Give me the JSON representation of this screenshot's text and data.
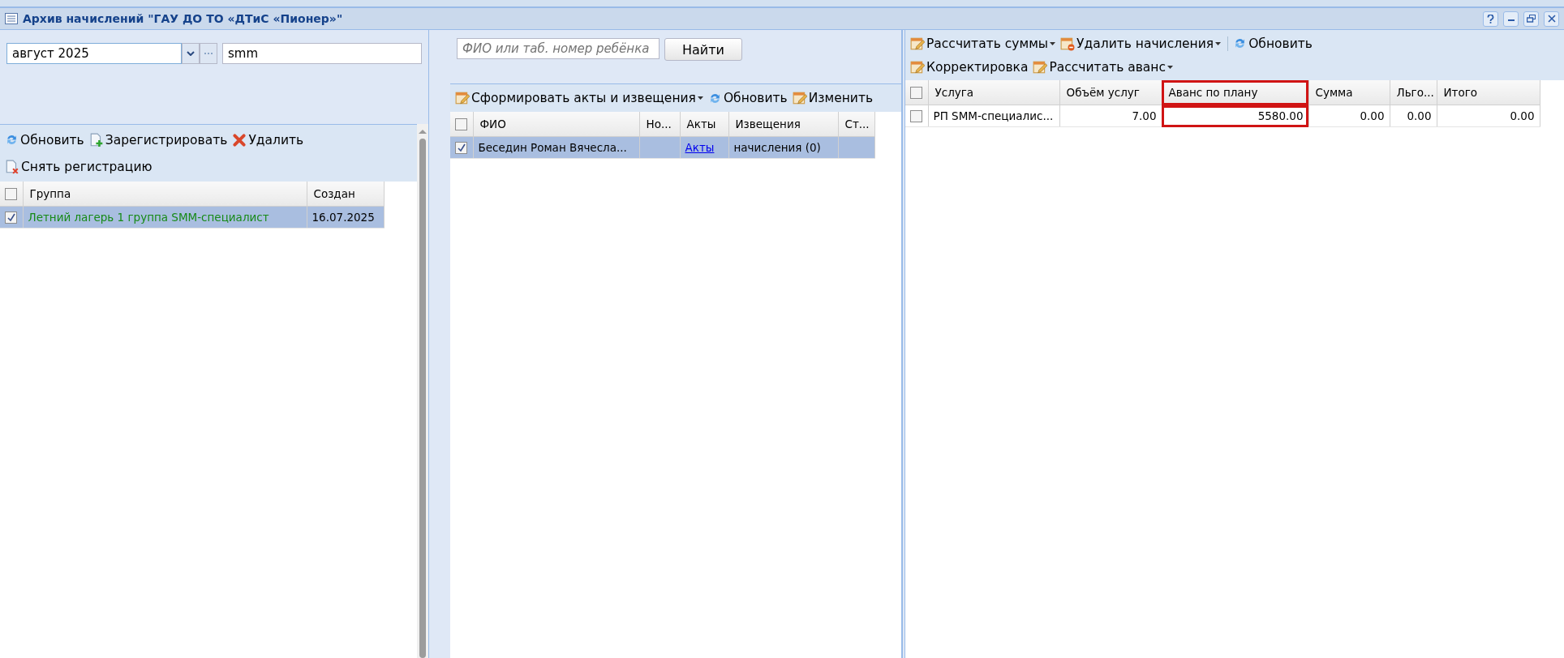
{
  "window": {
    "title": "Архив начислений \"ГАУ ДО ТО «ДТиС «Пионер»\""
  },
  "left_panel": {
    "period": {
      "value": "август 2025"
    },
    "filter": {
      "value": "smm"
    },
    "toolbar_rows": [
      [
        {
          "label": "Обновить",
          "kind": "refresh",
          "dropdown": false
        },
        {
          "label": "Зарегистрировать",
          "kind": "add",
          "dropdown": false
        },
        {
          "label": "Удалить",
          "kind": "delete",
          "dropdown": false
        }
      ],
      [
        {
          "label": "Снять регистрацию",
          "kind": "unregister",
          "dropdown": false
        }
      ]
    ],
    "grid": {
      "all_checked": false,
      "columns": [
        {
          "label": "Группа",
          "highlighted": false
        },
        {
          "label": "Создан",
          "highlighted": false
        }
      ],
      "rows": [
        {
          "selected": true,
          "cells": [
            {
              "text": "Летний лагерь 1 группа SMM-специалист",
              "kind": "text"
            },
            {
              "text": "16.07.2025",
              "kind": "text"
            }
          ]
        }
      ]
    }
  },
  "middle_panel": {
    "search": {
      "placeholder": "ФИО или таб. номер ребёнка"
    },
    "search_button": "Найти",
    "toolbar_rows": [
      [
        {
          "label": "Сформировать акты и извещения",
          "kind": "edit",
          "dropdown": true
        },
        {
          "label": "Обновить",
          "kind": "refresh",
          "dropdown": false
        },
        {
          "label": "Изменить",
          "kind": "edit",
          "dropdown": false
        }
      ]
    ],
    "grid": {
      "all_checked": false,
      "columns": [
        {
          "label": "ФИО",
          "highlighted": false
        },
        {
          "label": "Но...",
          "highlighted": false
        },
        {
          "label": "Акты",
          "highlighted": false
        },
        {
          "label": "Извещения",
          "highlighted": false
        },
        {
          "label": "Ст...",
          "highlighted": false
        }
      ],
      "rows": [
        {
          "selected": true,
          "cells": [
            {
              "text": "Беседин Роман Вячесла...",
              "kind": "text"
            },
            {
              "kind": "empty"
            },
            {
              "text": "Акты",
              "kind": "link"
            },
            {
              "text": "начисления (0)",
              "kind": "text"
            },
            {
              "kind": "empty"
            }
          ]
        }
      ]
    }
  },
  "right_panel": {
    "toolbar_rows": [
      [
        {
          "label": "Рассчитать суммы",
          "kind": "edit",
          "dropdown": true
        },
        {
          "label": "Удалить начисления",
          "kind": "remove",
          "dropdown": true
        },
        {
          "label": "Обновить",
          "kind": "refresh",
          "dropdown": false
        }
      ],
      [
        {
          "label": "Корректировка",
          "kind": "edit",
          "dropdown": false
        },
        {
          "label": "Рассчитать аванс",
          "kind": "edit",
          "dropdown": true
        }
      ]
    ],
    "grid": {
      "all_checked": false,
      "columns": [
        {
          "label": "Услуга",
          "highlighted": false
        },
        {
          "label": "Объём услуг",
          "highlighted": false
        },
        {
          "label": "Аванс по плану",
          "highlighted": true
        },
        {
          "label": "Сумма",
          "highlighted": false
        },
        {
          "label": "Льго...",
          "highlighted": false
        },
        {
          "label": "Итого",
          "highlighted": false
        }
      ],
      "rows": [
        {
          "selected": false,
          "cells": [
            {
              "text": "РП SMM-специалис...",
              "kind": "text"
            },
            {
              "text": "7.00",
              "kind": "text"
            },
            {
              "text": "5580.00",
              "kind": "text"
            },
            {
              "text": "0.00",
              "kind": "text"
            },
            {
              "text": "0.00",
              "kind": "text"
            },
            {
              "text": "0.00",
              "kind": "text"
            }
          ]
        }
      ]
    }
  }
}
